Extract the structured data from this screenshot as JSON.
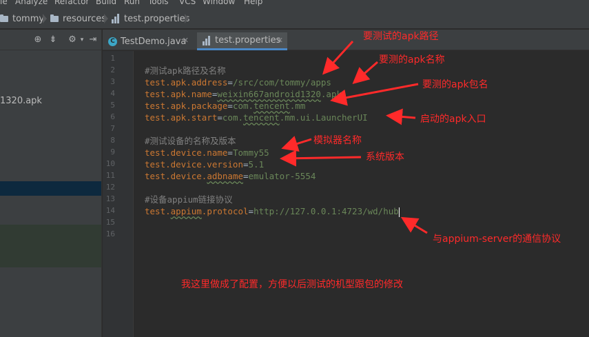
{
  "menu": [
    "le",
    "Analyze",
    "Refactor",
    "Build",
    "Run",
    "Tools",
    "VCS",
    "Window",
    "Help"
  ],
  "breadcrumb": [
    "tommy",
    "resources",
    "test.properties"
  ],
  "project_panel": {
    "visible_file": "1320.apk"
  },
  "tabs": [
    {
      "label": "TestDemo.java",
      "active": false
    },
    {
      "label": "test.properties",
      "active": true
    }
  ],
  "editor": {
    "line_numbers": [
      "1",
      "2",
      "3",
      "4",
      "5",
      "6",
      "7",
      "8",
      "9",
      "10",
      "11",
      "12",
      "13",
      "14",
      "15",
      "16"
    ],
    "lines": [
      {
        "n": "1",
        "text": ""
      },
      {
        "n": "2",
        "comment": "#测试apk路径及名称"
      },
      {
        "n": "3",
        "key": "test.apk.address",
        "value": "/src/com/tommy/apps"
      },
      {
        "n": "4",
        "key": "test.apk.name",
        "value": "weixin667android1320.apk"
      },
      {
        "n": "5",
        "key": "test.apk.package",
        "value": "com.tencent.mm"
      },
      {
        "n": "6",
        "key": "test.apk.start",
        "value": "com.tencent.mm.ui.LauncherUI"
      },
      {
        "n": "7",
        "text": ""
      },
      {
        "n": "8",
        "comment": "#测试设备的名称及版本"
      },
      {
        "n": "9",
        "key": "test.device.name",
        "value": "Tommy55"
      },
      {
        "n": "10",
        "key": "test.device.version",
        "value": "5.1"
      },
      {
        "n": "11",
        "key": "test.device.adbname",
        "value": "emulator-5554"
      },
      {
        "n": "12",
        "text": ""
      },
      {
        "n": "13",
        "comment": "#设备appium链接协议"
      },
      {
        "n": "14",
        "key": "test.appium.protocol",
        "value": "http://127.0.0.1:4723/wd/hub"
      },
      {
        "n": "15",
        "text": ""
      },
      {
        "n": "16",
        "text": ""
      }
    ]
  },
  "annotations": {
    "apk_path": "要测试的apk路径",
    "apk_name": "要测的apk名称",
    "apk_package": "要测的apk包名",
    "apk_start": "启动的apk入口",
    "device_name": "模拟器名称",
    "device_version": "系统版本",
    "appium_protocol": "与appium-server的通信协议",
    "summary": "我这里做成了配置，方便以后测试的机型跟包的修改"
  },
  "colors": {
    "editor_bg": "#2b2b2b",
    "key": "#cc7832",
    "value": "#6a8759",
    "comment": "#808080",
    "annotation": "#ff2a2a"
  }
}
